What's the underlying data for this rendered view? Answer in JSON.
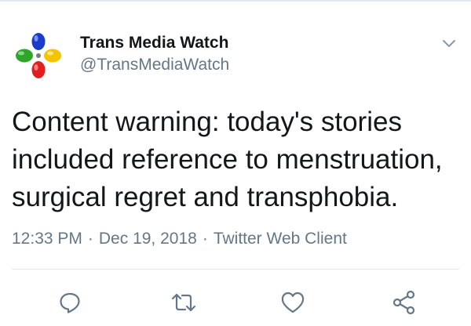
{
  "author": {
    "display_name": "Trans Media Watch",
    "handle": "@TransMediaWatch",
    "avatar_icon": "colorful-balloon-cross-logo"
  },
  "tweet": {
    "text": "Content warning: today's stories included reference to menstruation, surgical regret and transphobia."
  },
  "meta": {
    "time": "12:33 PM",
    "separator": "·",
    "date": "Dec 19, 2018",
    "client": "Twitter Web Client"
  },
  "actions": [
    {
      "icon": "reply-icon"
    },
    {
      "icon": "retweet-icon"
    },
    {
      "icon": "like-icon"
    },
    {
      "icon": "share-icon"
    }
  ],
  "colors": {
    "text_primary": "#14171a",
    "text_secondary": "#657786",
    "divider": "#e1e8ed",
    "logo_blue": "#1a3cc8",
    "logo_green": "#2fa52a",
    "logo_yellow": "#f5c400",
    "logo_red": "#e02020"
  }
}
